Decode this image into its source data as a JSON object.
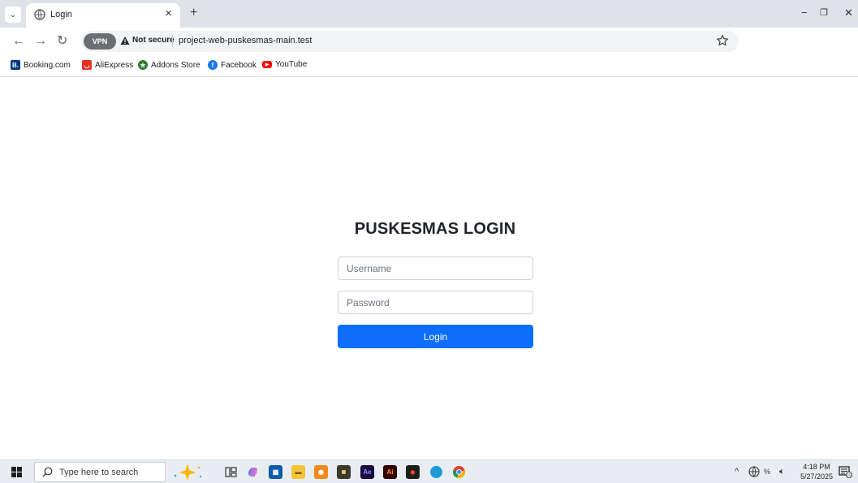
{
  "browser": {
    "tab": {
      "title": "Login"
    },
    "new_tab_symbol": "+",
    "controls": {
      "minimize": "−",
      "restore": "❐",
      "close": "✕"
    },
    "address_bar": {
      "vpn_label": "VPN",
      "security_label": "Not secure",
      "url": "project-web-puskesmas-main.test"
    },
    "bookmarks": [
      {
        "label": "Booking.com",
        "icon": "booking-icon",
        "color": "#003580"
      },
      {
        "label": "AliExpress",
        "icon": "aliexpress-icon",
        "color": "#e43225"
      },
      {
        "label": "Addons Store",
        "icon": "addons-store-icon",
        "color": "#2e7d32"
      },
      {
        "label": "Facebook",
        "icon": "facebook-icon",
        "color": "#1877f2"
      },
      {
        "label": "YouTube",
        "icon": "youtube-icon",
        "color": "#ff0000"
      }
    ]
  },
  "login": {
    "title": "PUSKESMAS LOGIN",
    "username_placeholder": "Username",
    "password_placeholder": "Password",
    "button_label": "Login"
  },
  "taskbar": {
    "search_placeholder": "Type here to search",
    "apps": [
      {
        "icon": "copilot-sparkle-icon"
      },
      {
        "icon": "task-view-icon"
      },
      {
        "icon": "copilot-icon"
      },
      {
        "icon": "store-icon"
      },
      {
        "icon": "file-explorer-icon"
      },
      {
        "icon": "orange-app-icon"
      },
      {
        "icon": "game-app-icon"
      },
      {
        "icon": "after-effects-icon"
      },
      {
        "icon": "illustrator-icon"
      },
      {
        "icon": "figma-icon"
      },
      {
        "icon": "blue-app-icon"
      },
      {
        "icon": "chrome-icon"
      }
    ],
    "clock": {
      "time": "4:18 PM",
      "date": "5/27/2025"
    },
    "notification_count": "15"
  },
  "colors": {
    "primary_button": "#0d6efd",
    "tab_strip": "#dfe3e7",
    "taskbar": "#e9edf1"
  }
}
